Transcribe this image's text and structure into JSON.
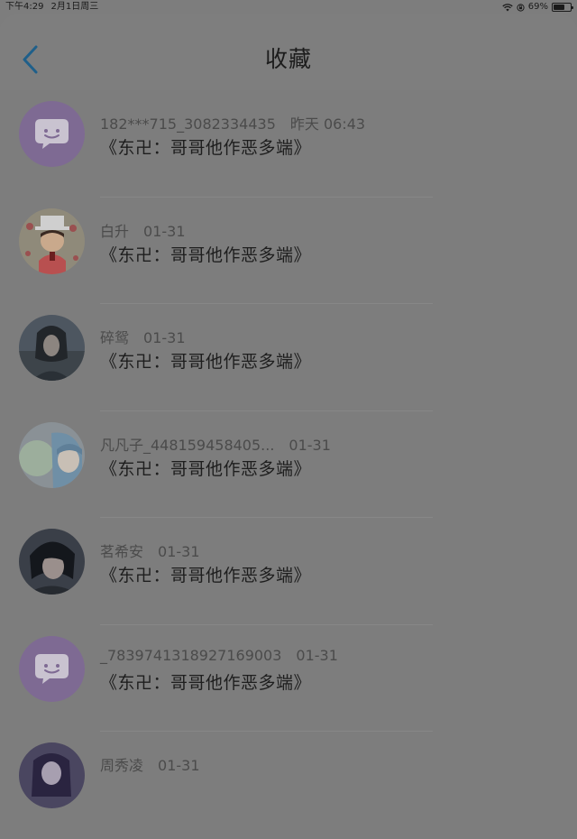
{
  "status_bar": {
    "time": "下午4:29",
    "date": "2月1日周三",
    "battery": "69%",
    "battery_level": 0.69
  },
  "nav": {
    "title": "收藏",
    "back_icon": "chevron-left-icon",
    "accent_color": "#1f5f8a"
  },
  "items": [
    {
      "user": "182***715_3082334435",
      "date": "昨天 06:43",
      "title": "《东卍：哥哥他作恶多端》",
      "avatar": "default-chat-avatar"
    },
    {
      "user": "白升",
      "date": "01-31",
      "title": "《东卍：哥哥他作恶多端》",
      "avatar": "cartoon-magician-avatar"
    },
    {
      "user": "碎鸳",
      "date": "01-31",
      "title": "《东卍：哥哥他作恶多端》",
      "avatar": "dark-haired-man-avatar"
    },
    {
      "user": "凡凡子_448159458405...",
      "date": "01-31",
      "title": "《东卍：哥哥他作恶多端》",
      "avatar": "anime-girl-bubble-avatar"
    },
    {
      "user": "茗希安",
      "date": "01-31",
      "title": "《东卍：哥哥他作恶多端》",
      "avatar": "dark-hair-anime-avatar"
    },
    {
      "user": "_7839741318927169003",
      "date": "01-31",
      "title": "《东卍：哥哥他作恶多端》",
      "avatar": "default-chat-avatar"
    },
    {
      "user": "周秀凌",
      "date": "01-31",
      "title": "",
      "avatar": "purple-anime-avatar"
    }
  ]
}
